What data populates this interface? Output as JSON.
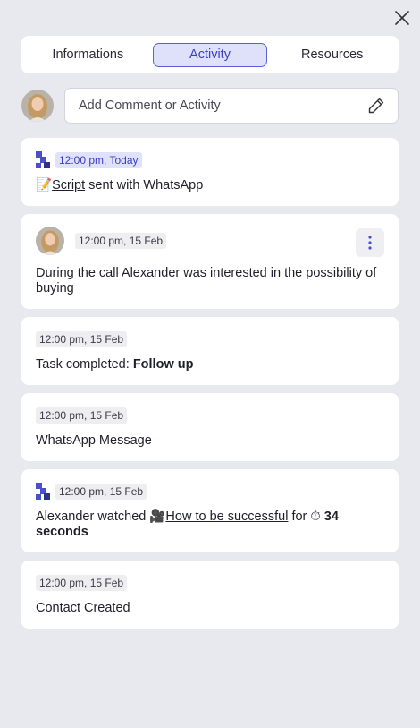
{
  "close_icon": "close-icon",
  "tabs": [
    {
      "label": "Informations",
      "active": false
    },
    {
      "label": "Activity",
      "active": true
    },
    {
      "label": "Resources",
      "active": false
    }
  ],
  "composer": {
    "placeholder": "Add Comment or Activity",
    "edit_icon": "pencil-icon"
  },
  "colors": {
    "accent": "#4a4fd0",
    "brand_logo": "#4a4fd0",
    "background": "#e8e9ee"
  },
  "activities": [
    {
      "timestamp": "12:00 pm, Today",
      "icon": "memo-emoji",
      "link": "Script",
      "text": "sent with WhatsApp"
    },
    {
      "timestamp": "12:00 pm, 15 Feb",
      "text": "During the call Alexander was interested in the possibility of buying",
      "menu_icon": "more-vertical-icon"
    },
    {
      "timestamp": "12:00 pm, 15 Feb",
      "prefix": "Task completed:",
      "bold": "Follow up"
    },
    {
      "timestamp": "12:00 pm, 15 Feb",
      "text": "WhatsApp Message"
    },
    {
      "timestamp": "12:00 pm, 15 Feb",
      "prefix": "Alexander watched",
      "video_icon": "video-camera-emoji",
      "link": "How to be successful",
      "mid": "for",
      "timer_icon": "stopwatch-emoji",
      "bold": "34 seconds"
    },
    {
      "timestamp": "12:00 pm, 15 Feb",
      "text": "Contact Created"
    }
  ]
}
